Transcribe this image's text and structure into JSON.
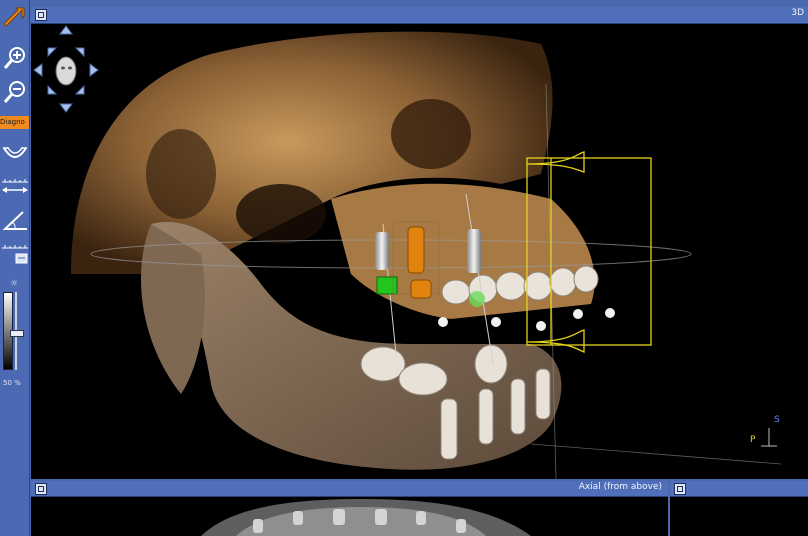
{
  "toolbar": {
    "diagnose_tab": "Diagno",
    "brightness_label": "☼",
    "contrast_value": "50 %",
    "tools": [
      "pointer-tool",
      "zoom-in-tool",
      "zoom-out-tool",
      "panoramic-curve-tool",
      "distance-measure-tool",
      "angle-measure-tool",
      "density-tool"
    ]
  },
  "panes": {
    "view3d": {
      "title": "3D"
    },
    "axial": {
      "title": "Axial (from above)"
    },
    "right": {
      "title": ""
    }
  },
  "orientation": {
    "s_label": "S",
    "p_label": "P"
  },
  "colors": {
    "toolbar_bg": "#4b6ab3",
    "titlebar_bg": "#4f6fba",
    "active_tab": "#f08a1c",
    "implant_green": "#22c51e",
    "implant_orange": "#e0830f",
    "guide_box": "#e3d21a",
    "bone": "#b4874e"
  }
}
